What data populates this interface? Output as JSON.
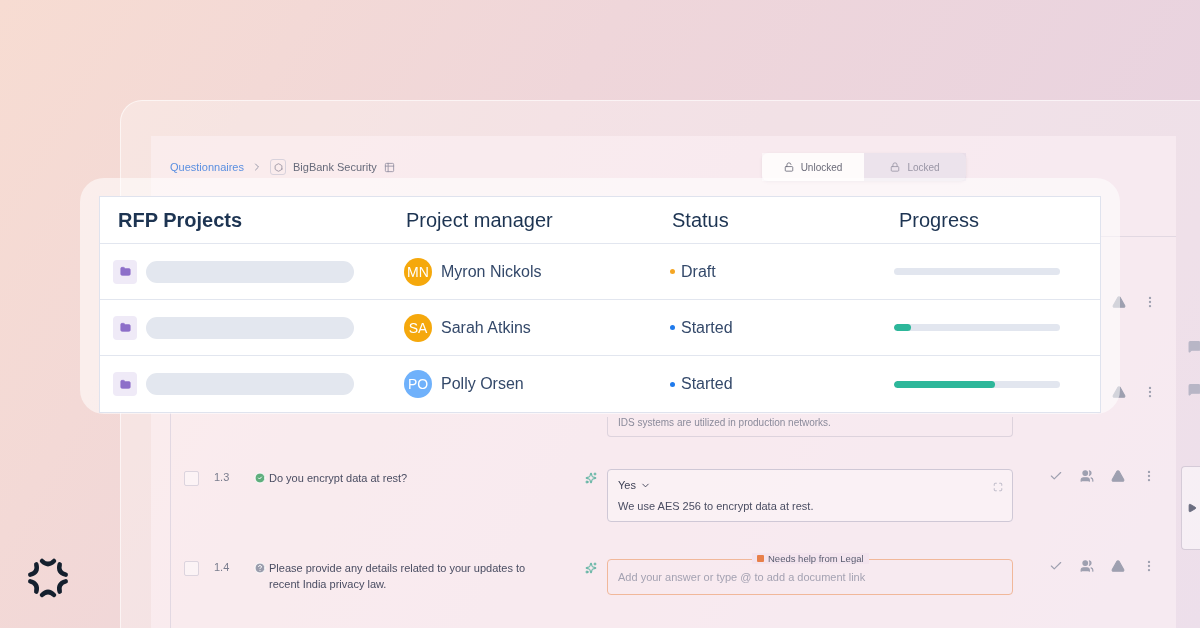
{
  "breadcrumb": [
    {
      "label": "Questionnaires",
      "kind": "link"
    },
    {
      "label": "BigBank Security",
      "kind": "current"
    }
  ],
  "lock_toggle": [
    {
      "label": "Unlocked",
      "kind": "unlocked",
      "selected": true
    },
    {
      "label": "Locked",
      "kind": "locked",
      "selected": false
    }
  ],
  "questions": [
    {
      "kind": "covered"
    },
    {
      "kind": "covered",
      "answer": "IDS systems are utilized in production networks."
    },
    {
      "kind": "question",
      "number": "1.3",
      "checked": false,
      "answered": true,
      "question": "Do you encrypt data at rest?",
      "answer": {
        "kind": "filled",
        "choice": "Yes",
        "text": "We use AES 256 to encrypt data at rest."
      }
    },
    {
      "kind": "question",
      "number": "1.4",
      "checked": false,
      "answered": false,
      "question": "Please provide any details related to your updates to recent India privacy law.",
      "answer": {
        "kind": "empty",
        "placeholder": "Add your answer or type @ to add a document link",
        "flag": {
          "label": "Needs help from Legal",
          "color": "#e8804a"
        }
      }
    }
  ],
  "projects_table": {
    "columns": [
      "RFP Projects",
      "Project manager",
      "Status",
      "Progress"
    ],
    "rows": [
      {
        "avatar": {
          "initials": "MN",
          "color": "#f5a80c"
        },
        "manager": "Myron Nickols",
        "status": {
          "label": "Draft",
          "color": "#f5a623"
        },
        "level": 0
      },
      {
        "avatar": {
          "initials": "SA",
          "color": "#f5a80c"
        },
        "manager": "Sarah Atkins",
        "status": {
          "label": "Started",
          "color": "#1f7aec"
        },
        "level": 0.1
      },
      {
        "avatar": {
          "initials": "PO",
          "color": "#6fb1fb"
        },
        "manager": "Polly Orsen",
        "status": {
          "label": "Started",
          "color": "#1f7aec"
        },
        "level": 0.61
      }
    ]
  }
}
